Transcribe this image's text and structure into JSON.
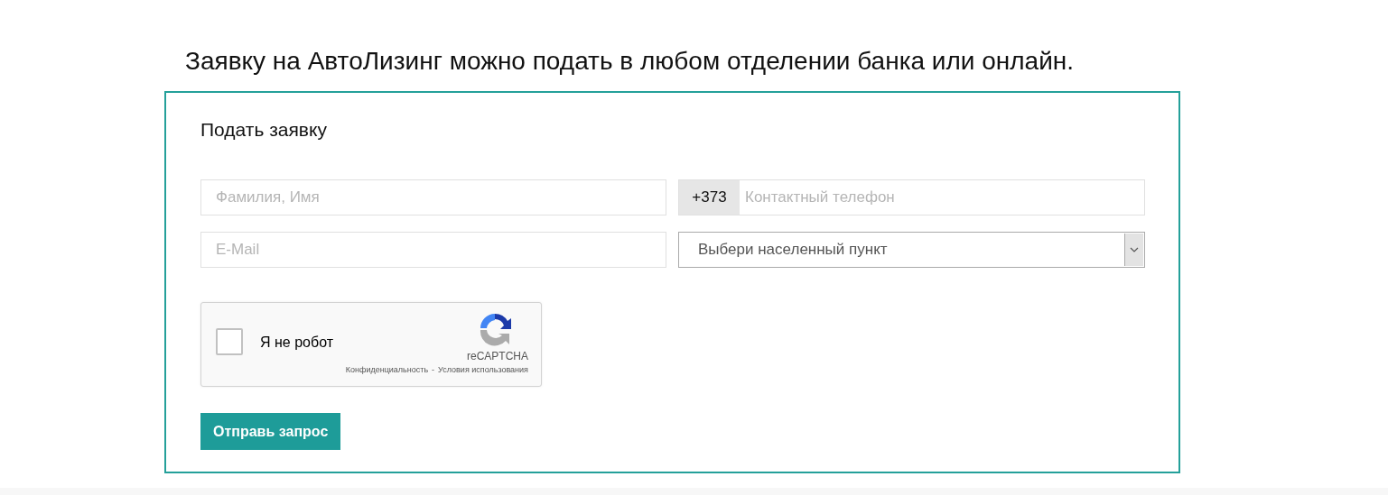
{
  "heading": "Заявку на АвтоЛизинг можно подать в любом отделении банка или онлайн.",
  "form": {
    "title": "Подать заявку",
    "name_field": {
      "placeholder": "Фамилия, Имя"
    },
    "phone_field": {
      "prefix": "+373",
      "placeholder": "Контактный телефон"
    },
    "email_field": {
      "placeholder": "E-Mail"
    },
    "locality_select": {
      "value": "Выбери населенный пункт"
    },
    "captcha": {
      "checked": false,
      "label": "Я не робот",
      "brand": "reCAPTCHA",
      "privacy_link": "Конфиденциальность",
      "separator": "-",
      "terms_link": "Условия использования"
    },
    "submit_button": "Отправь запрос"
  }
}
